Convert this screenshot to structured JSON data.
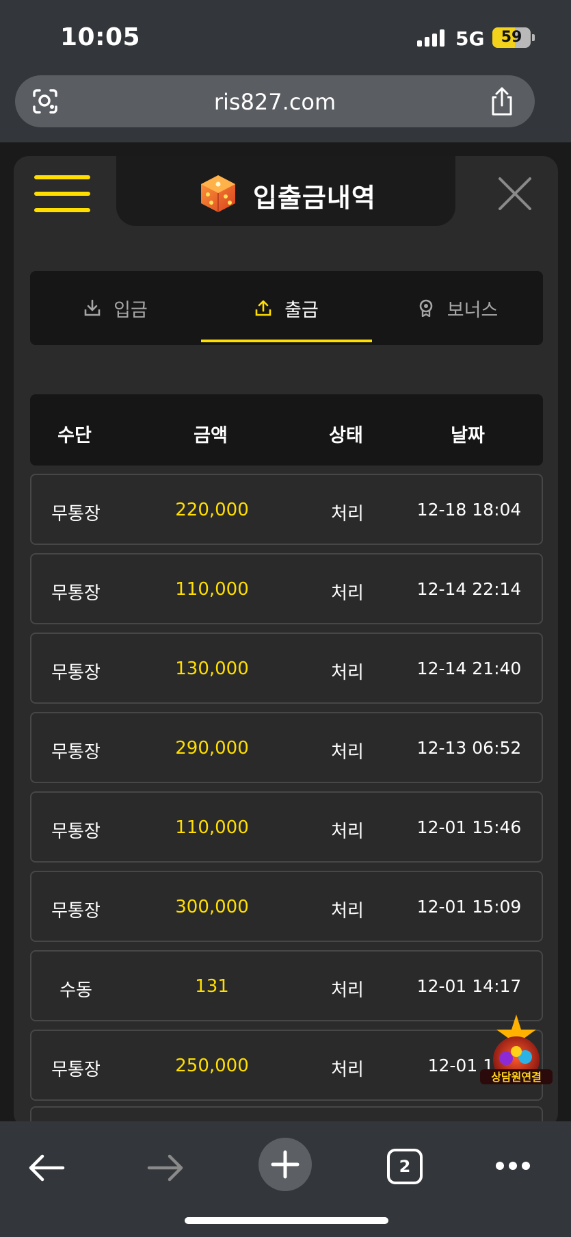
{
  "status_bar": {
    "time": "10:05",
    "network": "5G",
    "battery": "59",
    "battery_level": 0.59
  },
  "browser": {
    "url": "ris827.com",
    "tab_count": "2"
  },
  "modal": {
    "title": "입출금내역",
    "tabs": [
      {
        "label": "입금",
        "icon": "download-icon",
        "active": false
      },
      {
        "label": "출금",
        "icon": "upload-icon",
        "active": true
      },
      {
        "label": "보너스",
        "icon": "badge-icon",
        "active": false
      }
    ],
    "table": {
      "headers": [
        "수단",
        "금액",
        "상태",
        "날짜"
      ],
      "rows": [
        {
          "method": "무통장",
          "amount": "220,000",
          "status": "처리",
          "date": "12-18 18:04"
        },
        {
          "method": "무통장",
          "amount": "110,000",
          "status": "처리",
          "date": "12-14 22:14"
        },
        {
          "method": "무통장",
          "amount": "130,000",
          "status": "처리",
          "date": "12-14 21:40"
        },
        {
          "method": "무통장",
          "amount": "290,000",
          "status": "처리",
          "date": "12-13 06:52"
        },
        {
          "method": "무통장",
          "amount": "110,000",
          "status": "처리",
          "date": "12-01 15:46"
        },
        {
          "method": "무통장",
          "amount": "300,000",
          "status": "처리",
          "date": "12-01 15:09"
        },
        {
          "method": "수동",
          "amount": "131",
          "status": "처리",
          "date": "12-01 14:17"
        },
        {
          "method": "무통장",
          "amount": "250,000",
          "status": "처리",
          "date": "12-01 14:"
        }
      ]
    }
  },
  "floating_badge": {
    "label": "상담원연결"
  },
  "colors": {
    "accent": "#ffde00",
    "modal_bg": "#2b2b2b",
    "header_bg": "#161616"
  }
}
